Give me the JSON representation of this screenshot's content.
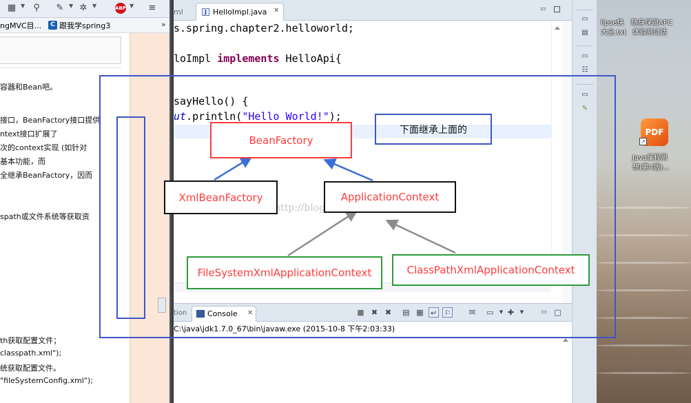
{
  "browser": {
    "bookmarks": [
      {
        "label": "ngMVC目..."
      },
      {
        "label": "跟我学spring3"
      }
    ],
    "bookmark_more": "»",
    "abp_label": "ABP",
    "article_lines": [
      "容器和Bean吧。",
      "接口，BeanFactory接口提供",
      "ntext接口扩展了",
      "次的context实现 (如针对",
      "基本功能，而",
      "全继承BeanFactory，因而",
      "spath或文件系统等获取资",
      "th获取配置文件；",
      "classpath.xml\");",
      "统获取配置文件。",
      "\"fileSystemConfig.xml\");"
    ]
  },
  "editor": {
    "prev_tab": "ml",
    "active_tab": "HelloImpl.java",
    "code": {
      "line1_text": "s.spring.chapter2.helloworld;",
      "line2_pre": "loImpl ",
      "line2_kw": "implements",
      "line2_post": " HelloApi{",
      "line3_text": "sayHello() {",
      "line4_field": "ut",
      "line4_pre": ".println(",
      "line4_str": "\"Hello World!\"",
      "line4_post": ");"
    }
  },
  "console": {
    "prev_view": "tion",
    "tab_label": "Console",
    "launch_text": "C:\\java\\jdk1.7.0_67\\bin\\javaw.exe (2015-10-8 下午2:03:33)"
  },
  "desktop": {
    "label_top_1": "lipse快",
    "label_top_2": "随身保温APC",
    "label_top_3": "大全.txt",
    "label_top_4": "体验测试活",
    "pdf_icon_text": "PDF",
    "pdf_label_1": "Java编程思",
    "pdf_label_2": "想(第4版)..."
  },
  "diagram": {
    "nodes": {
      "bean_factory": "BeanFactory",
      "xml_bean_factory": "XmlBeanFactory",
      "application_context": "ApplicationContext",
      "file_system_xml_application_context": "FileSystemXmlApplicationContext",
      "class_path_xml_application_context": "ClassPathXmlApplicationContext"
    },
    "note": "下面继承上面的",
    "watermark": "http://blog.csdn.net/",
    "colors": {
      "red": "#ff3b3b",
      "black": "#111111",
      "green": "#2e9a3a",
      "blue": "#3f55c8",
      "arrow_blue": "#3b6fd8",
      "arrow_gray": "#8c8c8c"
    }
  }
}
